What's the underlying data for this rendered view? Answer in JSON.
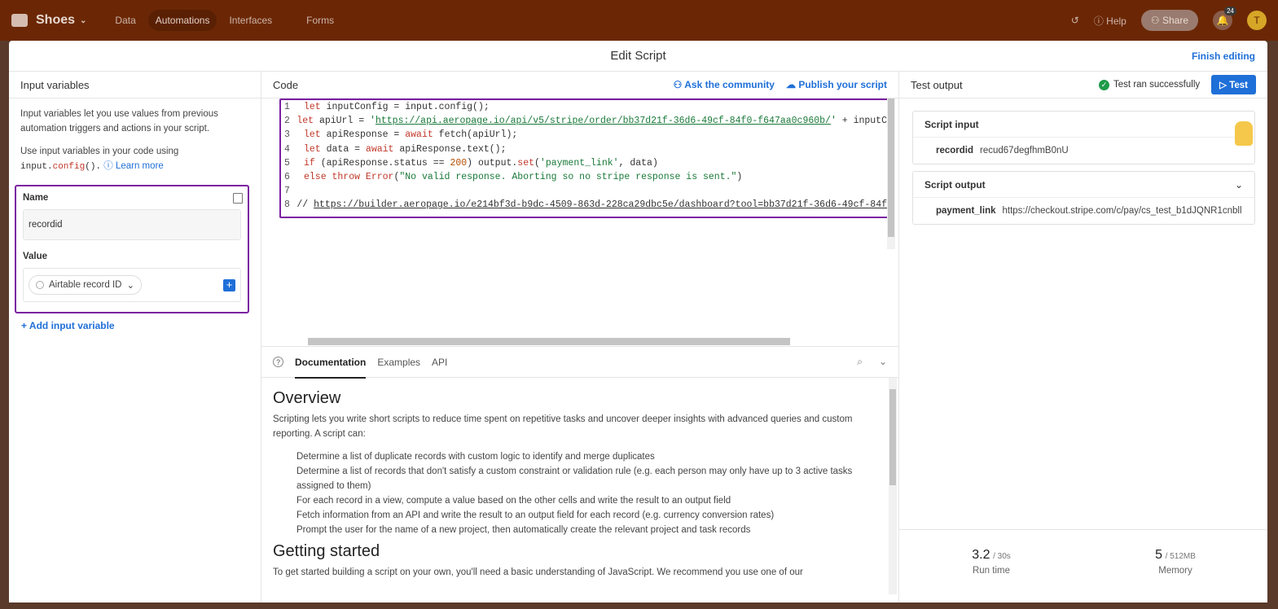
{
  "app": {
    "base_name": "Shoes"
  },
  "nav": [
    "Data",
    "Automations",
    "Interfaces",
    "Forms"
  ],
  "topright": {
    "help": "Help",
    "share": "Share",
    "notifications": "24",
    "avatar": "T"
  },
  "modal": {
    "title": "Edit Script",
    "finish": "Finish editing"
  },
  "left": {
    "title": "Input variables",
    "desc1": "Input variables let you use values from previous automation triggers and actions in your script.",
    "desc2": "Use input variables in your code using",
    "code_a": "input.",
    "code_b": "config",
    "code_c": "().",
    "learn": "Learn more",
    "name_label": "Name",
    "name_value": "recordid",
    "value_label": "Value",
    "value_value": "Airtable record ID",
    "add": "Add input variable"
  },
  "code": {
    "title": "Code",
    "ask": "Ask the community",
    "publish": "Publish your script",
    "line_numbers": [
      "1",
      "2",
      "3",
      "4",
      "5",
      "6",
      "7",
      "8"
    ]
  },
  "docs": {
    "tabs": [
      "Documentation",
      "Examples",
      "API"
    ],
    "h1": "Overview",
    "p1": "Scripting lets you write short scripts to reduce time spent on repetitive tasks and uncover deeper insights with advanced queries and custom reporting. A script can:",
    "items": [
      "Determine a list of duplicate records with custom logic to identify and merge duplicates",
      "Determine a list of records that don't satisfy a custom constraint or validation rule (e.g. each person may only have up to 3 active tasks assigned to them)",
      "For each record in a view, compute a value based on the other cells and write the result to an output field",
      "Fetch information from an API and write the result to an output field for each record (e.g. currency conversion rates)",
      "Prompt the user for the name of a new project, then automatically create the relevant project and task records"
    ],
    "h2": "Getting started",
    "p2": "To get started building a script on your own, you'll need a basic understanding of JavaScript. We recommend you use one of our"
  },
  "test": {
    "title": "Test output",
    "status": "Test ran successfully",
    "button": "Test",
    "input_title": "Script input",
    "input_key": "recordid",
    "input_val": "recud67degfhmB0nU",
    "output_title": "Script output",
    "output_key": "payment_link",
    "output_val": "https://checkout.stripe.com/c/pay/cs_test_b1dJQNR1cnbll",
    "runtime": "3.2",
    "runtime_limit": "/ 30s",
    "runtime_label": "Run time",
    "memory": "5",
    "memory_limit": "/ 512MB",
    "memory_label": "Memory"
  }
}
